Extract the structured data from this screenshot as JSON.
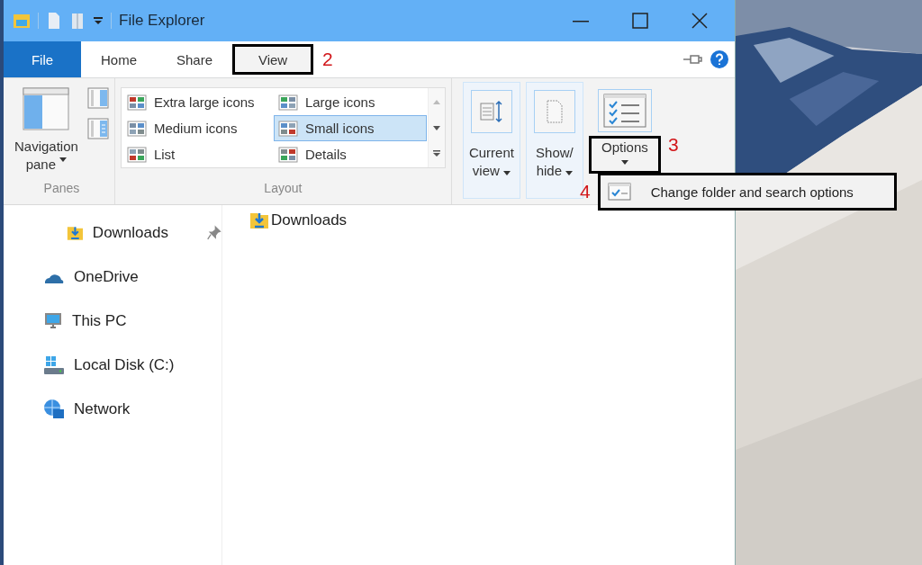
{
  "window": {
    "title": "File Explorer"
  },
  "tabs": [
    {
      "label": "File",
      "selected": false,
      "kind": "file",
      "highlighted": false
    },
    {
      "label": "Home",
      "selected": false,
      "kind": "tab",
      "highlighted": false
    },
    {
      "label": "Share",
      "selected": false,
      "kind": "tab",
      "highlighted": false
    },
    {
      "label": "View",
      "selected": true,
      "kind": "tab",
      "highlighted": true,
      "callout": "2"
    }
  ],
  "ribbon": {
    "groups": [
      {
        "label": "Panes"
      },
      {
        "label": "Layout"
      }
    ],
    "navigation_pane": {
      "label": "Navigation pane"
    },
    "layouts": [
      {
        "label": "Extra large icons",
        "selected": false
      },
      {
        "label": "Large icons",
        "selected": false
      },
      {
        "label": "Medium icons",
        "selected": false
      },
      {
        "label": "Small icons",
        "selected": true
      },
      {
        "label": "List",
        "selected": false
      },
      {
        "label": "Details",
        "selected": false
      }
    ],
    "buttons": [
      {
        "label": "Current view",
        "highlighted": false
      },
      {
        "label": "Show/ hide",
        "highlighted": false
      },
      {
        "label": "Options",
        "highlighted": true,
        "callout": "3"
      }
    ]
  },
  "dropdown": {
    "items": [
      {
        "label": "Change folder and search options",
        "highlighted": true,
        "callout": "4"
      }
    ]
  },
  "sidebar": {
    "items": [
      {
        "label": "Downloads",
        "pinned": true
      },
      {
        "label": "OneDrive",
        "pinned": false
      },
      {
        "label": "This PC",
        "pinned": false
      },
      {
        "label": "Local Disk (C:)",
        "pinned": false
      },
      {
        "label": "Network",
        "pinned": false
      }
    ]
  },
  "content": {
    "items": [
      {
        "label": "Downloads"
      }
    ]
  }
}
